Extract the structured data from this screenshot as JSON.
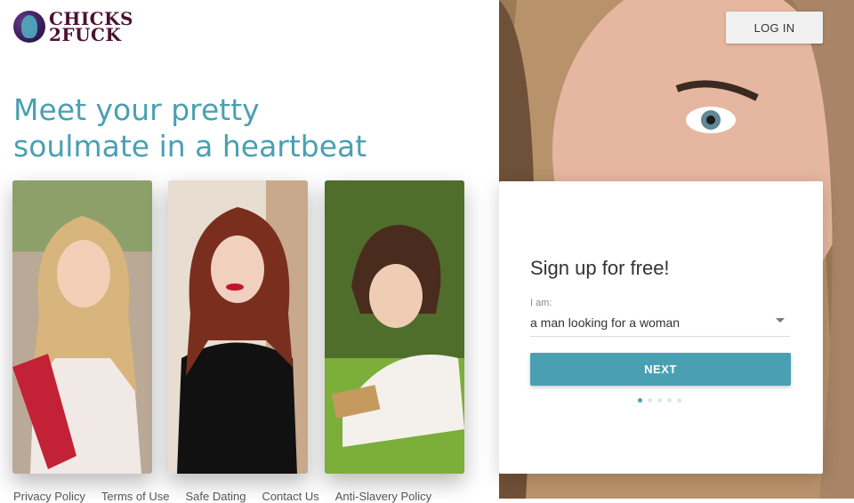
{
  "brand": {
    "logo_line1": "CHICKS",
    "logo_line2": "2FUCK",
    "colors": {
      "accent": "#4aa0b2",
      "logo": "#4a1233"
    }
  },
  "hero": {
    "headline": "Meet your pretty soulmate in a heartbeat"
  },
  "header": {
    "login_label": "LOG IN"
  },
  "signup": {
    "title": "Sign up for free!",
    "iam_label": "I am:",
    "selected_option": "a man looking for a woman",
    "next_label": "NEXT",
    "step_dots": {
      "total": 5,
      "active": 1
    }
  },
  "footer": {
    "links": [
      "Privacy Policy",
      "Terms of Use",
      "Safe Dating",
      "Contact Us",
      "Anti-Slavery Policy"
    ]
  },
  "icons": [
    "logo-mark-icon",
    "chevron-down-icon"
  ]
}
